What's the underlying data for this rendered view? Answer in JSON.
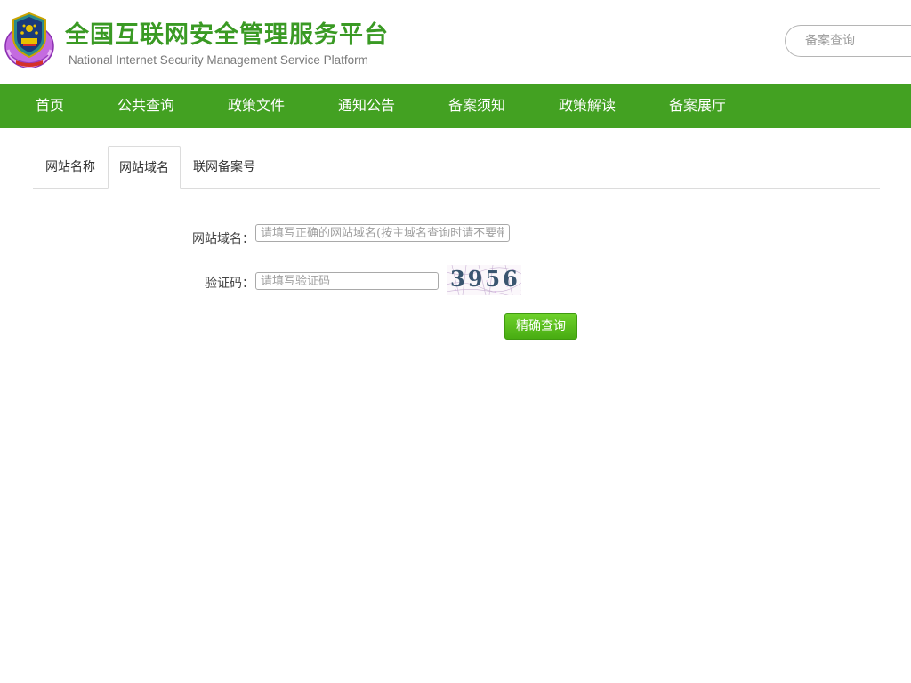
{
  "header": {
    "title_cn": "全国互联网安全管理服务平台",
    "title_en": "National Internet Security Management Service Platform",
    "search_placeholder": "备案查询",
    "emblem_icon": "police-emblem-icon",
    "brand_color": "#3a9a24"
  },
  "nav": {
    "background": "#43a122",
    "items": [
      {
        "label": "首页"
      },
      {
        "label": "公共查询"
      },
      {
        "label": "政策文件"
      },
      {
        "label": "通知公告"
      },
      {
        "label": "备案须知"
      },
      {
        "label": "政策解读"
      },
      {
        "label": "备案展厅"
      }
    ]
  },
  "tabs": {
    "items": [
      {
        "label": "网站名称"
      },
      {
        "label": "网站域名"
      },
      {
        "label": "联网备案号"
      }
    ],
    "active": "网站域名"
  },
  "form": {
    "domain_label": "网站域名：",
    "domain_value": "",
    "domain_placeholder": "请填写正确的网站域名(按主域名查询时请不要带www)",
    "captcha_label": "验证码：",
    "captcha_value": "",
    "captcha_placeholder": "请填写验证码",
    "captcha_text": "3956",
    "submit_label": "精确查询"
  }
}
